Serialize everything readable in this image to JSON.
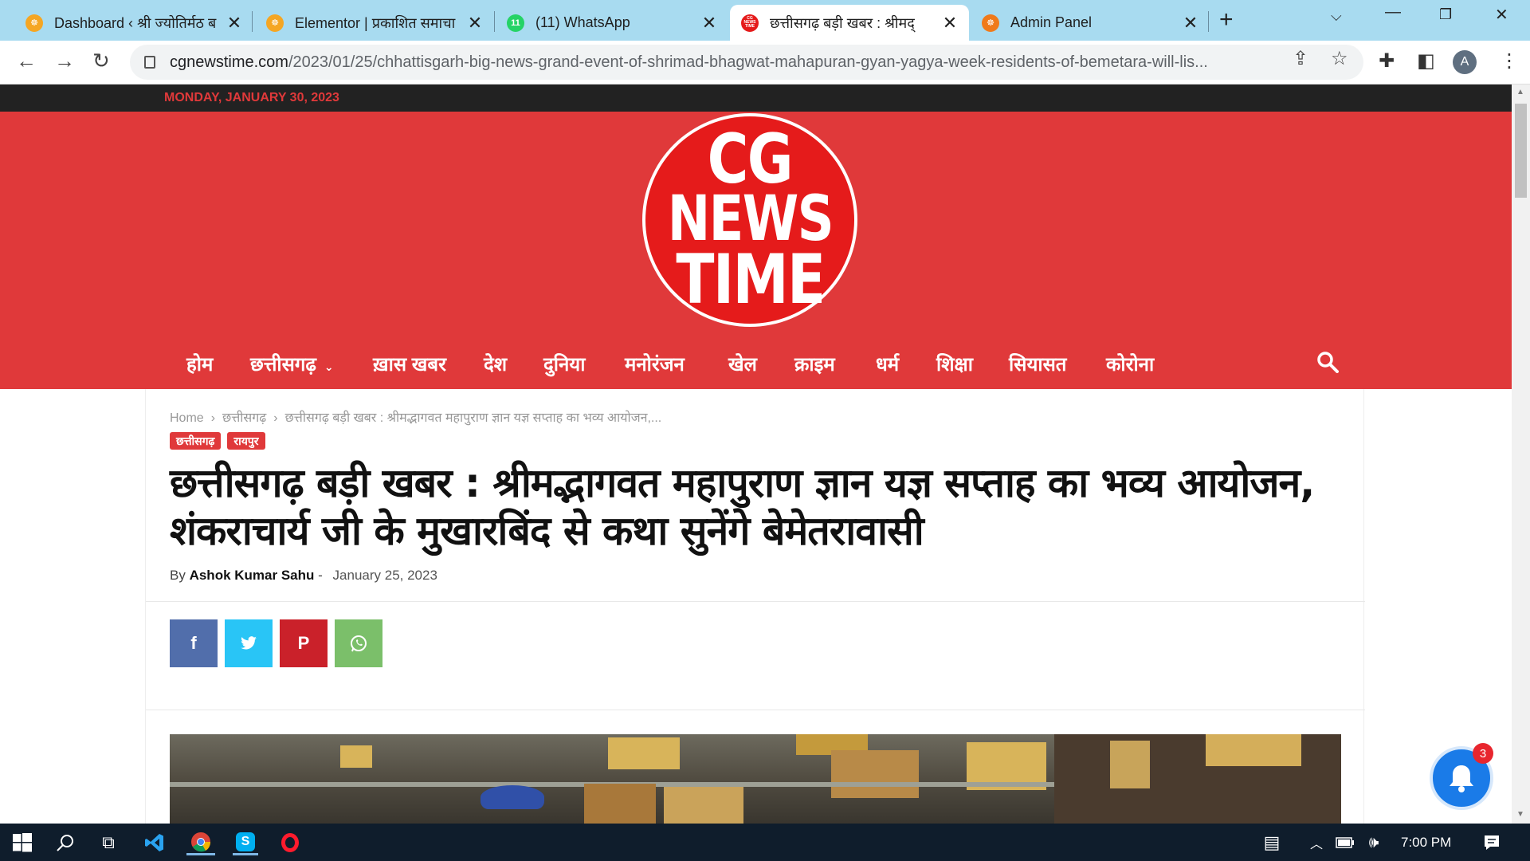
{
  "browser": {
    "tabs": [
      {
        "title": "Dashboard ‹ श्री ज्योतिर्मठ ब",
        "active": false
      },
      {
        "title": "Elementor | प्रकाशित समाचा",
        "active": false
      },
      {
        "title": "(11) WhatsApp",
        "active": false
      },
      {
        "title": "छत्तीसगढ़ बड़ी खबर : श्रीमद्",
        "active": true
      },
      {
        "title": "Admin Panel",
        "active": false
      }
    ],
    "whatsapp_badge": "11",
    "url_host": "cgnewstime.com",
    "url_path": "/2023/01/25/chhattisgarh-big-news-grand-event-of-shrimad-bhagwat-mahapuran-gyan-yagya-week-residents-of-bemetara-will-lis...",
    "profile_initial": "A"
  },
  "site": {
    "date": "MONDAY, JANUARY 30, 2023",
    "logo_lines": [
      "CG",
      "NEWS",
      "TIME"
    ],
    "favicon_text": "CG NEWS TIME",
    "nav": [
      "होम",
      "छत्तीसगढ़",
      "ख़ास खबर",
      "देश",
      "दुनिया",
      "मनोरंजन",
      "खेल",
      "क्राइम",
      "धर्म",
      "शिक्षा",
      "सियासत",
      "कोरोना"
    ]
  },
  "article": {
    "breadcrumb": [
      "Home",
      "छत्तीसगढ़",
      "छत्तीसगढ़ बड़ी खबर : श्रीमद्भागवत महापुराण ज्ञान यज्ञ सप्ताह का भव्य आयोजन,..."
    ],
    "categories": [
      "छत्तीसगढ़",
      "रायपुर"
    ],
    "title": "छत्तीसगढ़ बड़ी खबर : श्रीमद्भागवत महापुराण ज्ञान यज्ञ सप्ताह का भव्य आयोजन, शंकराचार्य जी के मुखारबिंद से कथा सुनेंगे बेमेतरावासी",
    "by_label": "By",
    "author": "Ashok Kumar Sahu",
    "byline_sep": "-",
    "date": "January 25, 2023",
    "share": [
      {
        "name": "facebook",
        "glyph": "f",
        "color": "#516eab"
      },
      {
        "name": "twitter",
        "glyph": "t",
        "color": "#29c5f6"
      },
      {
        "name": "pinterest",
        "glyph": "P",
        "color": "#ca212a"
      },
      {
        "name": "whatsapp",
        "glyph": "✆",
        "color": "#7bbf6a"
      }
    ]
  },
  "notifications": {
    "count": "3"
  },
  "taskbar": {
    "time": "7:00 PM"
  },
  "colors": {
    "accent": "#e0393a",
    "topbar": "#222222",
    "taskbar": "#0f1d2c"
  }
}
